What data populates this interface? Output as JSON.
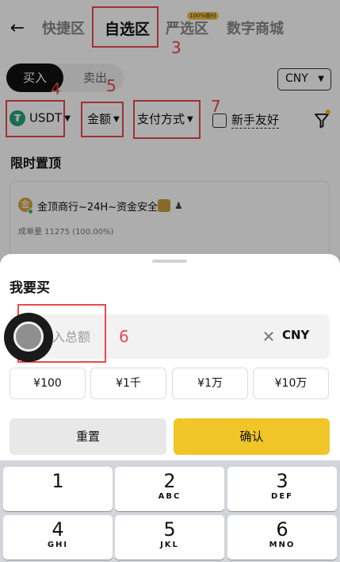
{
  "nav": {
    "tabs": [
      "快捷区",
      "自选区",
      "严选区",
      "数字商城"
    ],
    "badge": "100%赔付"
  },
  "trade": {
    "buy": "买入",
    "sell": "卖出"
  },
  "currency_select": "CNY",
  "filters": {
    "coin": "USDT",
    "amount": "金额",
    "payment": "支付方式",
    "newbie": "新手友好"
  },
  "section_title": "限时置顶",
  "merchant": {
    "avatar": "金",
    "name": "金顶商行~24H~资金安全",
    "stats": "成单量 11275 (100.00%)"
  },
  "annotations": [
    "3",
    "4",
    "5",
    "6",
    "7"
  ],
  "sheet": {
    "title": "我要买",
    "input_placeholder": "入总额",
    "unit": "CNY",
    "quick": [
      "¥100",
      "¥1千",
      "¥1万",
      "¥10万"
    ],
    "reset": "重置",
    "confirm": "确认"
  },
  "keypad": [
    {
      "digit": "1",
      "letters": ""
    },
    {
      "digit": "2",
      "letters": "ABC"
    },
    {
      "digit": "3",
      "letters": "DEF"
    },
    {
      "digit": "4",
      "letters": "GHI"
    },
    {
      "digit": "5",
      "letters": "JKL"
    },
    {
      "digit": "6",
      "letters": "MNO"
    }
  ],
  "colors": {
    "accent": "#f0c528",
    "annotation": "#e9494c",
    "tether": "#26a17b"
  }
}
